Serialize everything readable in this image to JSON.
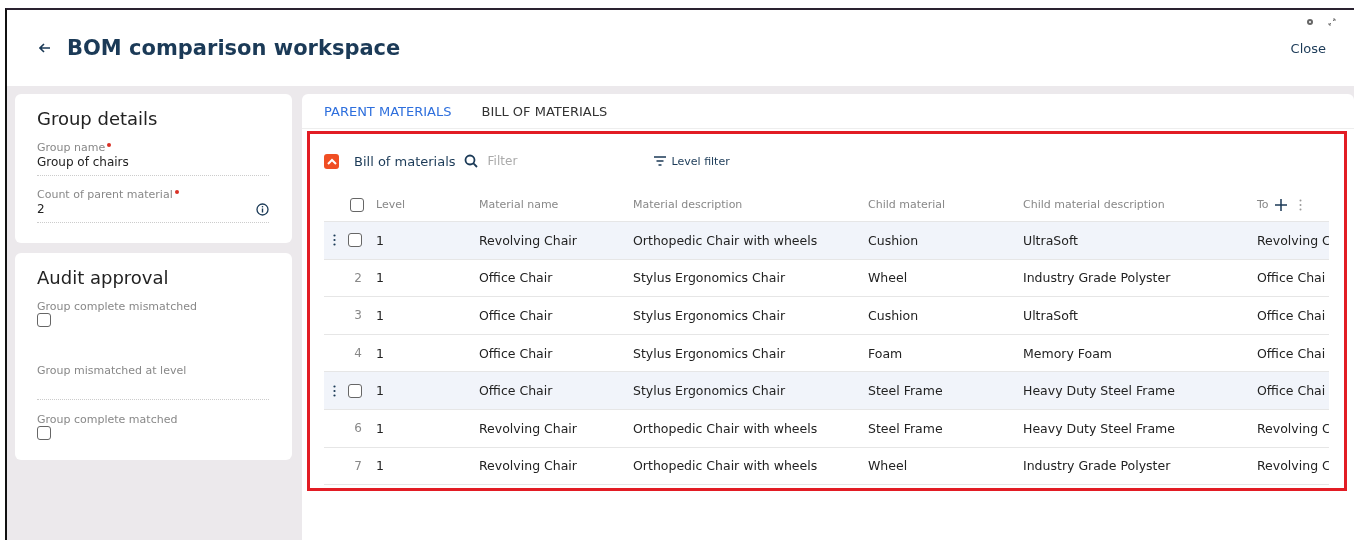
{
  "header": {
    "title": "BOM comparison workspace",
    "close": "Close"
  },
  "group_details": {
    "title": "Group details",
    "fields": [
      {
        "label": "Group name",
        "required": true,
        "value": "Group of chairs",
        "info": false
      },
      {
        "label": "Count of parent material",
        "required": true,
        "value": "2",
        "info": true
      }
    ]
  },
  "audit_approval": {
    "title": "Audit approval",
    "fields": [
      {
        "kind": "checkbox",
        "label": "Group complete mismatched",
        "checked": false
      },
      {
        "kind": "text",
        "label": "Group mismatched at level"
      },
      {
        "kind": "checkbox",
        "label": "Group complete matched",
        "checked": false
      }
    ]
  },
  "tabs": [
    {
      "label": "PARENT MATERIALS",
      "selected": true
    },
    {
      "label": "BILL OF MATERIALS",
      "selected": false
    }
  ],
  "table": {
    "title": "Bill of materials",
    "expanded": true,
    "filter_placeholder": "Filter",
    "select_all_checked": false,
    "level_filter": "Level filter",
    "columns": [
      "Level",
      "Material name",
      "Material description",
      "Child material",
      "Child material description",
      "To"
    ],
    "rows": [
      {
        "kind": "hovered",
        "checked": false,
        "cells": [
          "1",
          "Revolving Chair",
          "Orthopedic Chair with wheels",
          "Cushion",
          "UltraSoft",
          "Revolving C"
        ]
      },
      {
        "kind": "numbered",
        "number": "2",
        "cells": [
          "1",
          "Office Chair",
          "Stylus Ergonomics Chair",
          "Wheel",
          "Industry Grade Polyster",
          "Office Chai"
        ]
      },
      {
        "kind": "numbered",
        "number": "3",
        "cells": [
          "1",
          "Office Chair",
          "Stylus Ergonomics Chair",
          "Cushion",
          "UltraSoft",
          "Office Chai"
        ]
      },
      {
        "kind": "numbered",
        "number": "4",
        "cells": [
          "1",
          "Office Chair",
          "Stylus Ergonomics Chair",
          "Foam",
          "Memory Foam",
          "Office Chai"
        ]
      },
      {
        "kind": "hovered",
        "checked": false,
        "cells": [
          "1",
          "Office Chair",
          "Stylus Ergonomics Chair",
          "Steel Frame",
          "Heavy Duty Steel Frame",
          "Office Chai"
        ]
      },
      {
        "kind": "numbered",
        "number": "6",
        "cells": [
          "1",
          "Revolving Chair",
          "Orthopedic Chair with wheels",
          "Steel Frame",
          "Heavy Duty Steel Frame",
          "Revolving C"
        ]
      },
      {
        "kind": "numbered",
        "number": "7",
        "cells": [
          "1",
          "Revolving Chair",
          "Orthopedic Chair with wheels",
          "Wheel",
          "Industry Grade Polyster",
          "Revolving C"
        ]
      }
    ]
  }
}
